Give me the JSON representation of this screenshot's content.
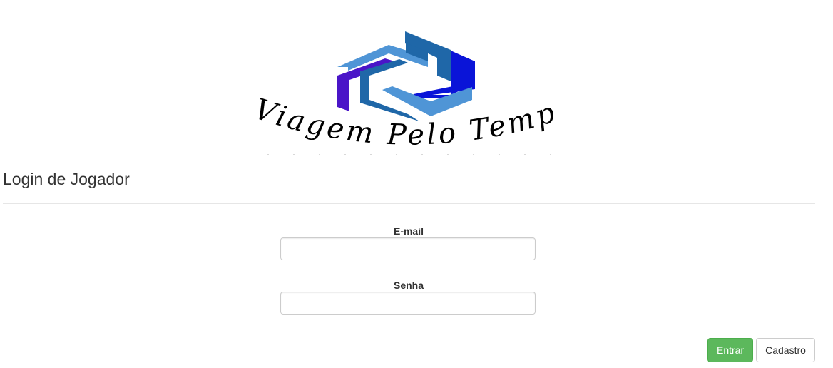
{
  "logo": {
    "brand_text": "Viagem Pelo Tempo",
    "colors": {
      "light_blue": "#4f95d6",
      "mid_blue": "#1f67a8",
      "deep_blue": "#0a14d8",
      "violet": "#4a15c8"
    }
  },
  "header": {
    "title": "Login de Jogador"
  },
  "form": {
    "email_label": "E-mail",
    "email_value": "",
    "password_label": "Senha",
    "password_value": ""
  },
  "actions": {
    "login_label": "Entrar",
    "register_label": "Cadastro",
    "login_color": "#5cb85c"
  }
}
